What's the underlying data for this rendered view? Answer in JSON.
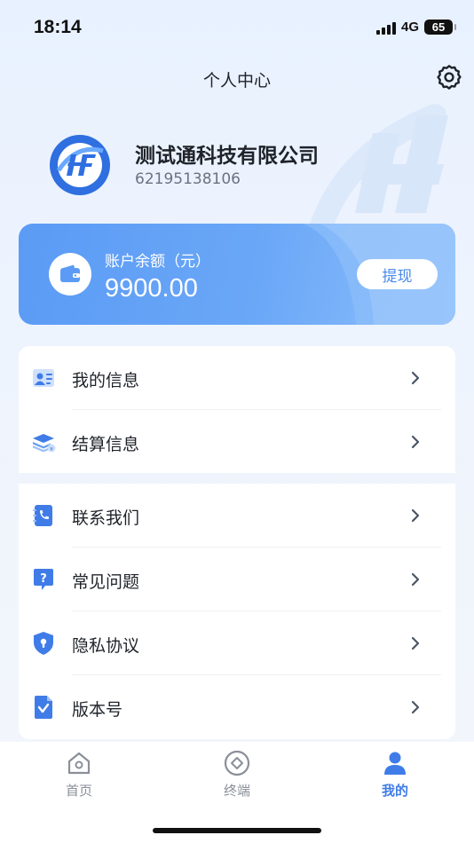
{
  "status_bar": {
    "time": "18:14",
    "network": "4G",
    "battery": "65"
  },
  "nav": {
    "title": "个人中心",
    "settings_icon": "gear-icon"
  },
  "profile": {
    "company_name": "测试通科技有限公司",
    "company_id": "62195138106",
    "avatar_icon": "hf-logo-icon"
  },
  "balance": {
    "label": "账户余额（元）",
    "amount": "9900.00",
    "withdraw_label": "提现",
    "wallet_icon": "wallet-icon"
  },
  "menu_group_1": [
    {
      "label": "我的信息",
      "icon": "id-card-icon"
    },
    {
      "label": "结算信息",
      "icon": "money-stack-icon"
    }
  ],
  "menu_group_2": [
    {
      "label": "联系我们",
      "icon": "phone-book-icon"
    },
    {
      "label": "常见问题",
      "icon": "question-icon"
    },
    {
      "label": "隐私协议",
      "icon": "shield-lock-icon"
    },
    {
      "label": "版本号",
      "icon": "document-check-icon"
    }
  ],
  "tabbar": [
    {
      "label": "首页",
      "icon": "home-icon",
      "active": false
    },
    {
      "label": "终端",
      "icon": "terminal-icon",
      "active": false
    },
    {
      "label": "我的",
      "icon": "user-icon",
      "active": true
    }
  ],
  "colors": {
    "accent": "#3f7ce8",
    "card_start": "#5b9bf5",
    "card_end": "#8ec0fb",
    "text": "#1f2329",
    "muted": "#6b7280"
  }
}
